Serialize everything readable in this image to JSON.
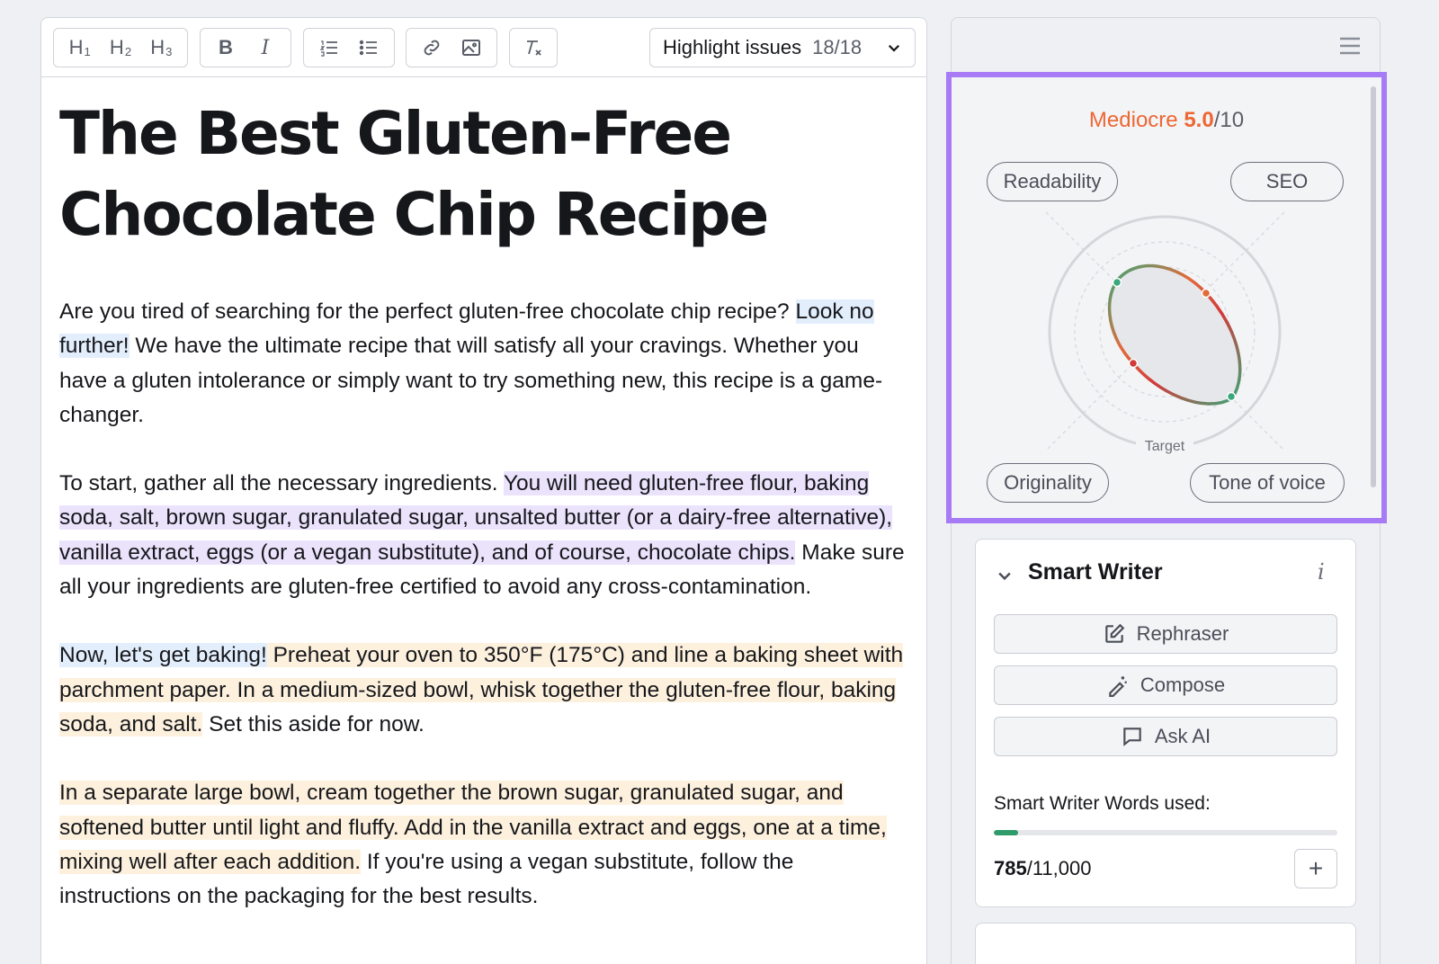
{
  "toolbar": {
    "h1_label": "H",
    "h1_sub": "1",
    "h2_label": "H",
    "h2_sub": "2",
    "h3_label": "H",
    "h3_sub": "3",
    "bold_label": "B",
    "italic_label": "I",
    "highlight_label": "Highlight issues",
    "highlight_count": "18/18"
  },
  "document": {
    "title": "The Best Gluten-Free Chocolate Chip Recipe",
    "paragraphs": [
      {
        "s1": "Are you tired of searching for the perfect gluten-free chocolate chip recipe? ",
        "s2": "Look no further!",
        "s3": " We have the ultimate recipe that will satisfy all your cravings. Whether you have a gluten intolerance or simply want to try something new, this recipe is a game-changer."
      },
      {
        "s1": "To start, gather all the necessary ingredients. ",
        "s2": "You will need gluten-free flour, baking soda, salt, brown sugar, granulated sugar, unsalted butter (or a dairy-free alternative), vanilla extract, eggs (or a vegan substitute), and of course, chocolate chips.",
        "s3": " Make sure all your ingredients are gluten-free certified to avoid any cross-contamination."
      },
      {
        "s1": "Now, let's get baking!",
        "s2": " Preheat your oven to 350°F (175°C) and line a baking sheet with parchment paper.",
        "s3": " In a medium-sized bowl, whisk together the gluten-free flour, baking soda, and salt.",
        "s4": " Set this aside for now."
      },
      {
        "s1": "In a separate large bowl, cream together the brown sugar, granulated sugar, and softened butter until light and fluffy. Add in the vanilla extract and eggs, one at a time, mixing well after each addition.",
        "s2": " If you're using a vegan substitute, follow the instructions on the packaging for the best results."
      }
    ]
  },
  "score": {
    "label": "Mediocre",
    "value": "5.0",
    "max": "/10",
    "color": "#ee6733",
    "panel_border_color": "#a67bf5",
    "axes": {
      "readability": "Readability",
      "seo": "SEO",
      "originality": "Originality",
      "tone": "Tone of voice"
    },
    "target_label": "Target"
  },
  "smart_writer": {
    "title": "Smart Writer",
    "info": "i",
    "rephraser": "Rephraser",
    "compose": "Compose",
    "ask_ai": "Ask AI",
    "words_label": "Smart Writer Words used:",
    "words_used": "785",
    "words_total": "/11,000",
    "words_fraction": 0.0714,
    "plus": "+"
  },
  "icons": [
    "link-icon",
    "image-icon",
    "clear-format-icon",
    "ordered-list-icon",
    "bullet-list-icon",
    "menu-icon",
    "chevron-down-icon",
    "edit-icon",
    "magic-pen-icon",
    "chat-icon"
  ]
}
